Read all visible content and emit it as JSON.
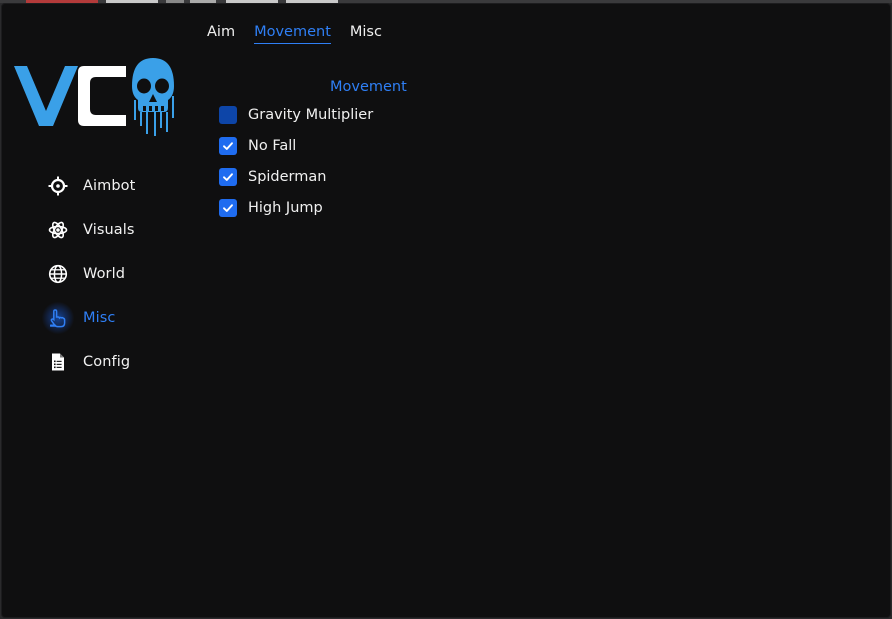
{
  "logo": {
    "text": "VC",
    "icon": "skull-icon"
  },
  "sidebar": {
    "items": [
      {
        "label": "Aimbot",
        "icon": "crosshair-icon",
        "active": false
      },
      {
        "label": "Visuals",
        "icon": "atom-icon",
        "active": false
      },
      {
        "label": "World",
        "icon": "globe-icon",
        "active": false
      },
      {
        "label": "Misc",
        "icon": "hand-pointer-icon",
        "active": true
      },
      {
        "label": "Config",
        "icon": "document-icon",
        "active": false
      }
    ]
  },
  "tabs": [
    {
      "label": "Aim",
      "active": false
    },
    {
      "label": "Movement",
      "active": true
    },
    {
      "label": "Misc",
      "active": false
    }
  ],
  "section": {
    "title": "Movement"
  },
  "options": [
    {
      "label": "Gravity Multiplier",
      "checked": false
    },
    {
      "label": "No Fall",
      "checked": true
    },
    {
      "label": "Spiderman",
      "checked": true
    },
    {
      "label": "High Jump",
      "checked": true
    }
  ],
  "colors": {
    "accent": "#2f7ff5",
    "background": "#0f0f10",
    "logo_blue": "#3aa0e8"
  }
}
